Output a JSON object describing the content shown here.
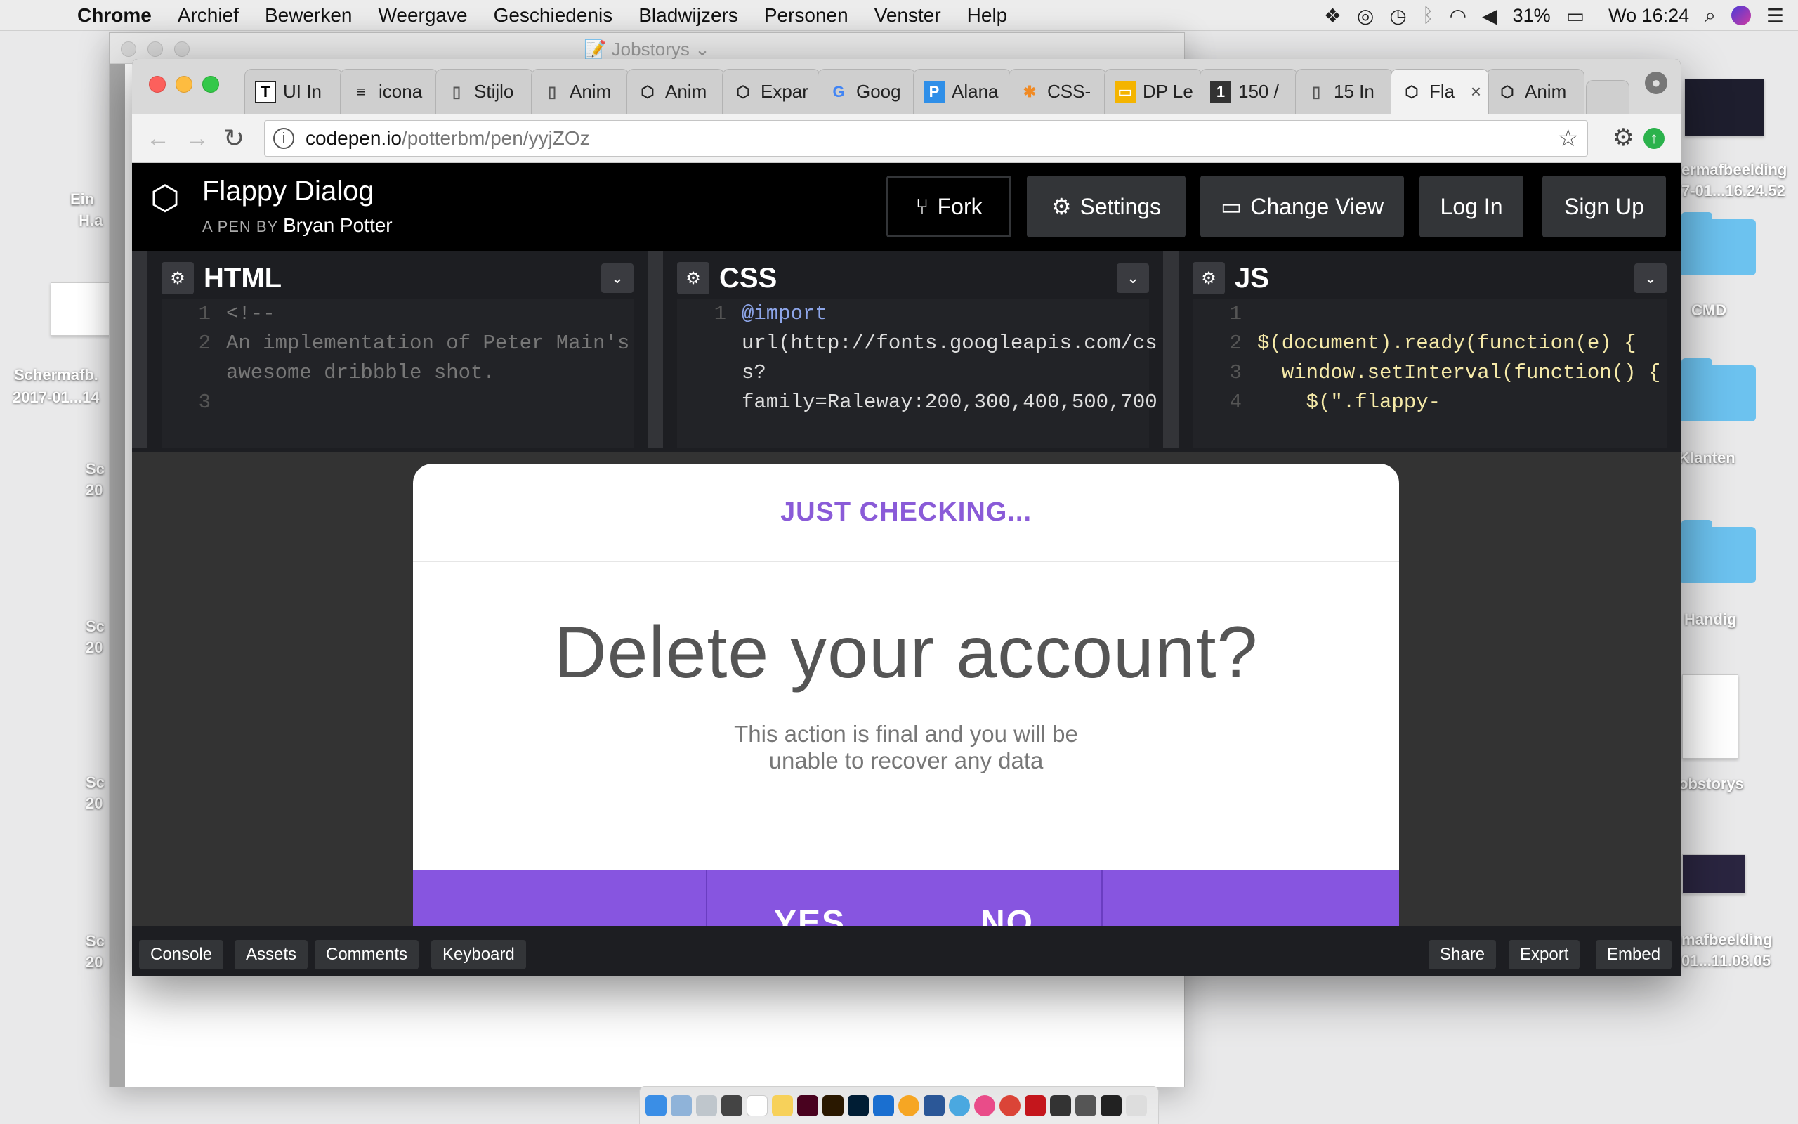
{
  "menubar": {
    "app": "Chrome",
    "items": [
      "Archief",
      "Bewerken",
      "Weergave",
      "Geschiedenis",
      "Bladwijzers",
      "Personen",
      "Venster",
      "Help"
    ],
    "battery": "31%",
    "clock": "Wo 16:24"
  },
  "desktop": {
    "labels": [
      "Ein",
      "H.a",
      "Schermafb.",
      "2017-01...14",
      "Sc",
      "20",
      "Sc",
      "20",
      "Sc",
      "20",
      "Sc",
      "20"
    ],
    "right_labels": [
      "ermafbeelding",
      "7-01...16.24.52",
      "CMD",
      "Klanten",
      "Handig",
      "obstorys",
      "mafbeelding",
      "01...11.08.05"
    ]
  },
  "back_window": {
    "title": "Jobstorys"
  },
  "browser": {
    "tabs": [
      {
        "label": "UI In",
        "icon": "T"
      },
      {
        "label": "icona",
        "icon": "≡"
      },
      {
        "label": "Stijlo",
        "icon": "doc"
      },
      {
        "label": "Anim",
        "icon": "doc"
      },
      {
        "label": "Anim",
        "icon": "cube"
      },
      {
        "label": "Expar",
        "icon": "cube"
      },
      {
        "label": "Goog",
        "icon": "G"
      },
      {
        "label": "Alana",
        "icon": "P"
      },
      {
        "label": "CSS-",
        "icon": "*"
      },
      {
        "label": "DP Le",
        "icon": "slide"
      },
      {
        "label": "150 /",
        "icon": "1"
      },
      {
        "label": "15 In",
        "icon": "doc"
      },
      {
        "label": "Fla",
        "icon": "cube"
      },
      {
        "label": "Anim",
        "icon": "cube"
      }
    ],
    "url_domain": "codepen.io",
    "url_path": "/potterbm/pen/yyjZOz"
  },
  "codepen": {
    "title": "Flappy Dialog",
    "by_prefix": "A PEN BY",
    "author": "Bryan Potter",
    "buttons": {
      "fork": "Fork",
      "settings": "Settings",
      "change_view": "Change View",
      "login": "Log In",
      "signup": "Sign Up"
    },
    "editors": {
      "html": {
        "title": "HTML",
        "lines": [
          "1",
          "2",
          "",
          "3"
        ],
        "code": [
          "<!--",
          "An implementation of Peter Main's",
          "awesome dribbble shot.",
          ""
        ]
      },
      "css": {
        "title": "CSS",
        "lines": [
          "1",
          "",
          "",
          "",
          ""
        ],
        "code": [
          "@import",
          "url(http://fonts.googleapis.com/cs",
          "s?",
          "family=Raleway:200,300,400,500,700"
        ]
      },
      "js": {
        "title": "JS",
        "lines": [
          "1",
          "2",
          "3",
          "4"
        ],
        "code": [
          "",
          "$(document).ready(function(e) {",
          "  window.setInterval(function() {",
          "    $(\".flappy-"
        ]
      }
    },
    "footer": {
      "left": [
        "Console",
        "Assets",
        "Comments",
        "Keyboard"
      ],
      "right": [
        "Share",
        "Export",
        "Embed"
      ]
    }
  },
  "dialog": {
    "header": "JUST CHECKING...",
    "title": "Delete your account?",
    "subtitle_1": "This action is final and you will be",
    "subtitle_2": "unable to recover any data",
    "yes": "YES",
    "no": "NO"
  },
  "colors": {
    "accent": "#8755e0",
    "header_text": "#8a5bd8"
  }
}
